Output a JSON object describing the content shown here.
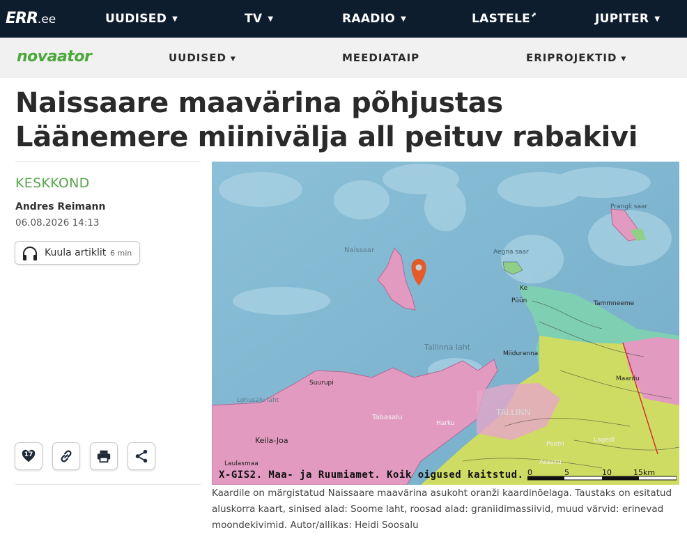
{
  "topbar": {
    "logo_main": "ERR",
    "logo_suffix": ".ee",
    "items": [
      {
        "label": "UUDISED",
        "caret": "▼"
      },
      {
        "label": "TV",
        "caret": "▼"
      },
      {
        "label": "RAADIO",
        "caret": "▼"
      },
      {
        "label": "LASTELE",
        "external": "⬈"
      },
      {
        "label": "JUPITER",
        "caret": "▼"
      }
    ]
  },
  "subbar": {
    "logo": "novaator",
    "items": [
      {
        "label": "UUDISED",
        "caret": "▼"
      },
      {
        "label": "MEEDIATAIP"
      },
      {
        "label": "ERIPROJEKTID",
        "caret": "▼"
      }
    ]
  },
  "article": {
    "title": "Naissaare maavärina põhjustas Läänemere miinivälja all peituv rabakivi",
    "category": "KESKKOND",
    "author": "Andres Reimann",
    "date": "06.08.2026 14:13",
    "listen_label": "Kuula artiklit",
    "listen_duration": "6 min",
    "likes": "17"
  },
  "icons": {
    "listen": "headphones-icon",
    "like": "heart-icon",
    "link": "link-icon",
    "print": "printer-icon",
    "share": "share-icon",
    "map_marker": "location-pin-icon"
  },
  "map": {
    "credit": "X-GIS2. Maa- ja Ruumiamet. Koik oigused kaitstud.",
    "scale_labels": [
      "0",
      "5",
      "10",
      "15km"
    ],
    "place_labels": {
      "naissaar": "Naissaar",
      "prangli": "Prangli saar",
      "aegna": "Aegna saar",
      "keri": "Ke",
      "tallinna_laht": "Tallinna laht",
      "miiduranna": "Miiduranna",
      "tallinn": "TALLINN",
      "lohusalu": "Lohusalu laht",
      "suurupi": "Suurupi",
      "tabasalu": "Tabasalu",
      "keila_joa": "Keila-Joa",
      "laulasmaa": "Laulasmaa",
      "harku": "Harku",
      "maardu": "Maardu",
      "tammneeme": "Tammneeme",
      "puunsi": "Püün",
      "lagedi": "Lagedi",
      "peetri": "Peetri",
      "assaku": "Assaku"
    },
    "marker_color": "#e65a28"
  },
  "caption": "Kaardile on märgistatud Naissaare maavärina asukoht oranži kaardinõelaga. Taustaks on esitatud aluskorra kaart, sinised alad: Soome laht, roosad alad: graniidimassiivid, muud värvid: erinevad moondekivimid. Autor/allikas: Heidi Soosalu",
  "colors": {
    "topbar_bg": "#0e1d2e",
    "brand_green": "#4ba83a",
    "sea": "#7fb6d1",
    "granite_pink": "#e29ac0",
    "metamorphic_yellow": "#cfdc63",
    "metamorphic_teal": "#7fcfb2"
  }
}
